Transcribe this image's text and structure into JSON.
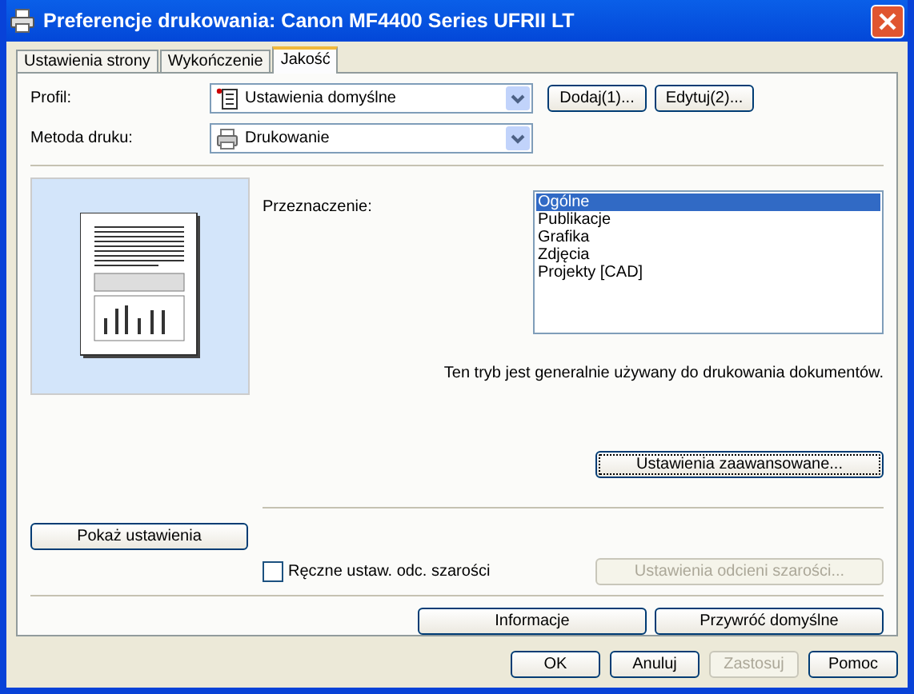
{
  "window": {
    "title": "Preferencje drukowania: Canon MF4400 Series UFRII LT"
  },
  "tabs": [
    {
      "label": "Ustawienia strony",
      "selected": false
    },
    {
      "label": "Wykończenie",
      "selected": false
    },
    {
      "label": "Jakość",
      "selected": true
    }
  ],
  "profile": {
    "label": "Profil:",
    "value": "Ustawienia domyślne",
    "buttons": [
      "Dodaj(1)...",
      "Edytuj(2)..."
    ]
  },
  "print_method": {
    "label": "Metoda druku:",
    "value": "Drukowanie"
  },
  "purpose": {
    "label": "Przeznaczenie:",
    "items": [
      {
        "label": "Ogólne",
        "selected": true
      },
      {
        "label": "Publikacje",
        "selected": false
      },
      {
        "label": "Grafika",
        "selected": false
      },
      {
        "label": "Zdjęcia",
        "selected": false
      },
      {
        "label": "Projekty [CAD]",
        "selected": false
      }
    ],
    "description": "Ten tryb jest generalnie używany do drukowania dokumentów."
  },
  "advanced_button": "Ustawienia zaawansowane...",
  "show_settings_button": "Pokaż ustawienia",
  "grayscale": {
    "label": "Ręczne ustaw. odc. szarości",
    "checked": false,
    "button": {
      "label": "Ustawienia odcieni szarości...",
      "disabled": true
    }
  },
  "info_button": "Informacje",
  "restore_button": "Przywróć domyślne",
  "dialog_buttons": [
    {
      "label": "OK",
      "disabled": false
    },
    {
      "label": "Anuluj",
      "disabled": false
    },
    {
      "label": "Zastosuj",
      "disabled": true
    },
    {
      "label": "Pomoc",
      "disabled": false
    }
  ]
}
